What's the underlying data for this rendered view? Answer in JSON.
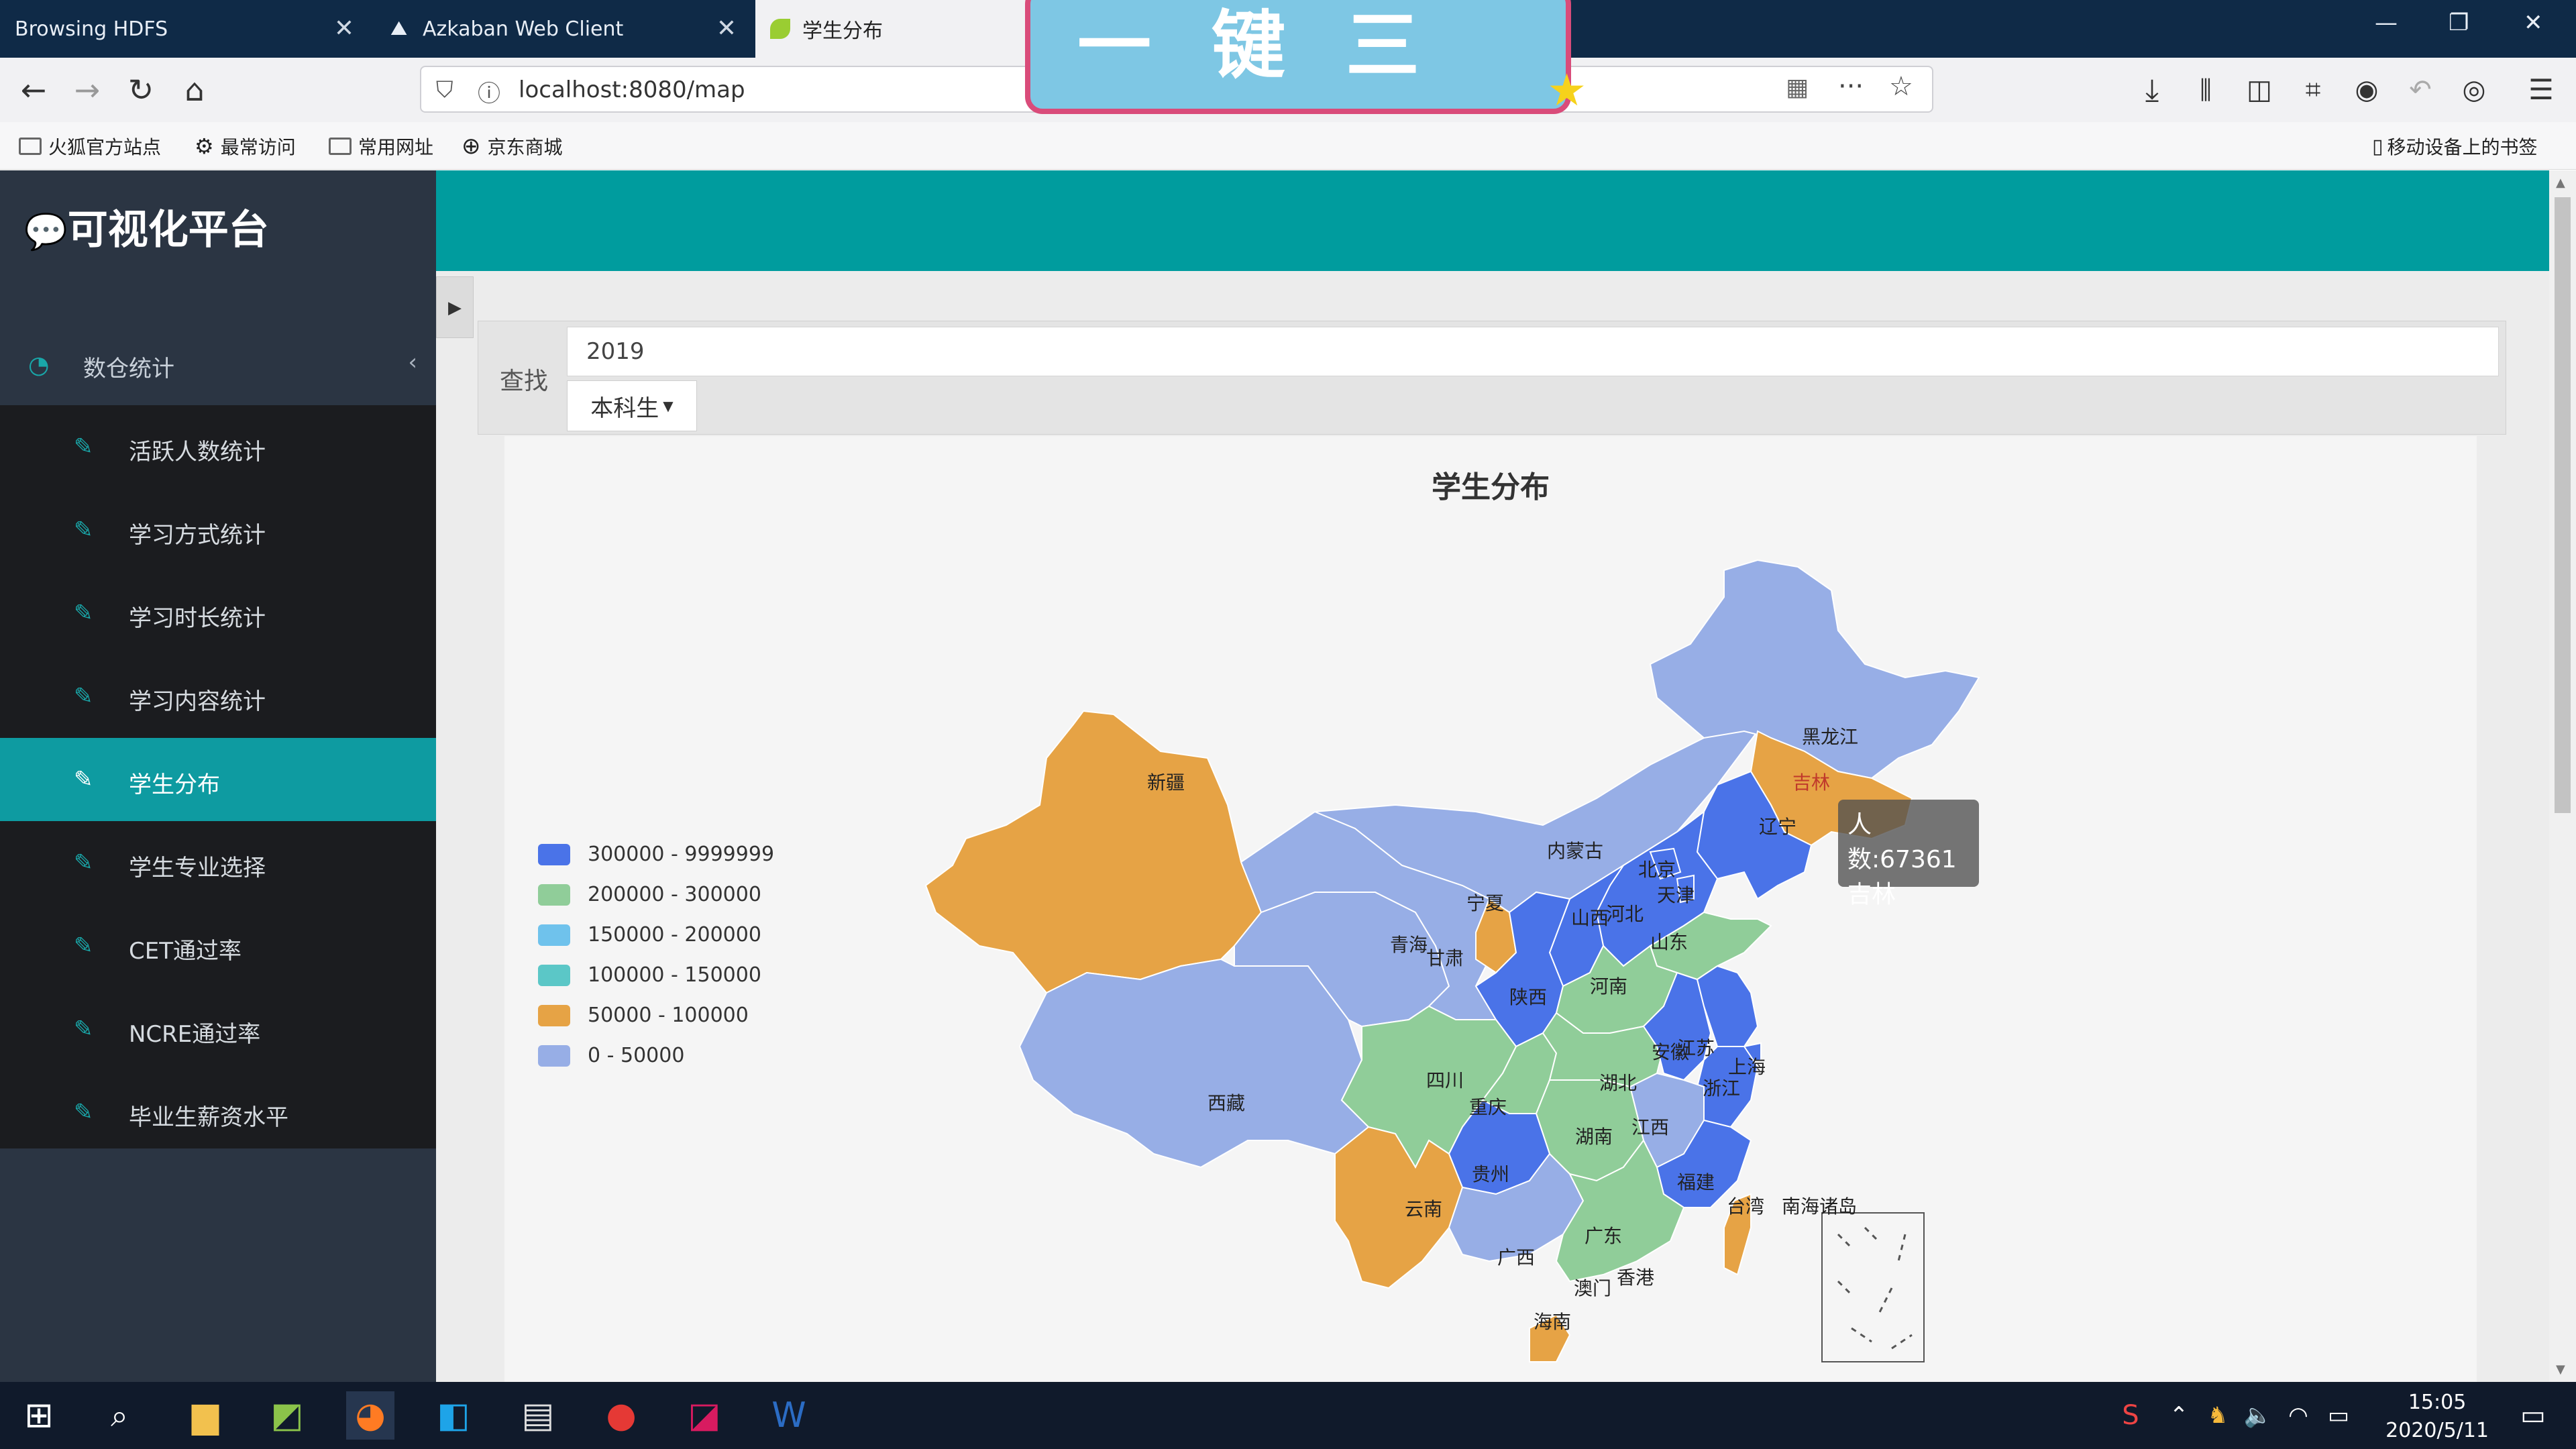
{
  "browser": {
    "tabs": [
      {
        "title": "Browsing HDFS"
      },
      {
        "title": "Azkaban Web Client"
      },
      {
        "title": "学生分布"
      }
    ],
    "url": "localhost:8080/map",
    "bookmarks": [
      "火狐官方站点",
      "最常访问",
      "常用网址",
      "京东商城"
    ],
    "mobile_bookmarks": "移动设备上的书签"
  },
  "overlay": {
    "banner_text": "一键三连"
  },
  "app": {
    "brand": "可视化平台",
    "menu_root": "数仓统计",
    "menu_items": [
      "活跃人数统计",
      "学习方式统计",
      "学习时长统计",
      "学习内容统计",
      "学生分布",
      "学生专业选择",
      "CET通过率",
      "NCRE通过率",
      "毕业生薪资水平"
    ],
    "active_menu": "学生分布"
  },
  "search": {
    "label": "查找",
    "year_value": "2019",
    "type_select": "本科生"
  },
  "chart": {
    "title": "学生分布",
    "tooltip": {
      "value_line": "人数:67361",
      "name_line": "吉林"
    },
    "province_labels": {
      "xinjiang": "新疆",
      "tibet": "西藏",
      "qinghai": "青海",
      "gansu": "甘肃",
      "ningxia": "宁夏",
      "neimenggu": "内蒙古",
      "heilongjiang": "黑龙江",
      "jilin": "吉林",
      "liaoning": "辽宁",
      "beijing": "北京",
      "tianjin": "天津",
      "hebei": "河北",
      "shanxi": "山西",
      "shandong": "山东",
      "henan": "河南",
      "shaanxi": "陕西",
      "sichuan": "四川",
      "chongqing": "重庆",
      "hubei": "湖北",
      "anhui": "安徽",
      "jiangsu": "江苏",
      "shanghai": "上海",
      "zhejiang": "浙江",
      "jiangxi": "江西",
      "hunan": "湖南",
      "guizhou": "贵州",
      "yunnan": "云南",
      "guangxi": "广西",
      "guangdong": "广东",
      "fujian": "福建",
      "taiwan": "台湾",
      "hainan": "海南",
      "hongkong": "香港",
      "macau": "澳门",
      "south_sea": "南海诸岛"
    },
    "colors": {
      "c300k": "#4a73e8",
      "c200k": "#90cd99",
      "c150k": "#6fc2ec",
      "c100k": "#5bc7c7",
      "c50k": "#e6a345",
      "c0": "#97aee6"
    }
  },
  "chart_data": {
    "type": "map",
    "title": "学生分布",
    "legend": [
      {
        "label": "300000 - 9999999",
        "color": "#4a73e8"
      },
      {
        "label": "200000 - 300000",
        "color": "#90cd99"
      },
      {
        "label": "150000 - 200000",
        "color": "#6fc2ec"
      },
      {
        "label": "100000 - 150000",
        "color": "#5bc7c7"
      },
      {
        "label": "50000 - 100000",
        "color": "#e6a345"
      },
      {
        "label": "0 - 50000",
        "color": "#97aee6"
      }
    ],
    "highlighted": {
      "name": "吉林",
      "value": 67361
    }
  },
  "taskbar": {
    "time": "15:05",
    "date": "2020/5/11"
  }
}
